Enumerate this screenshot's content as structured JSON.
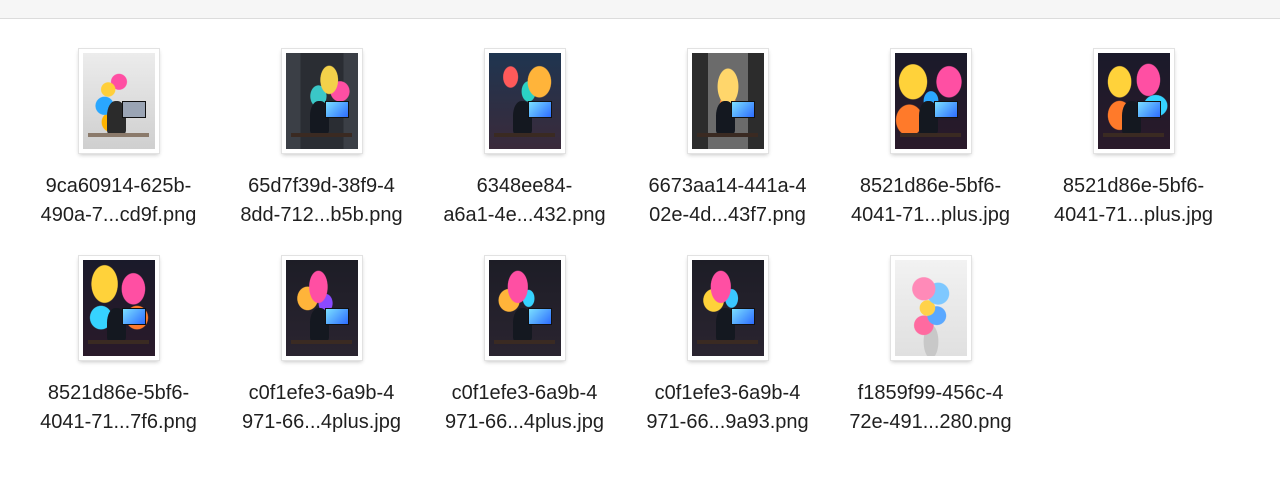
{
  "files": [
    {
      "name_line1": "9ca60914-625b-",
      "name_line2": "490a-7...cd9f.png",
      "thumbnail": "colorful-smoke-person-laptop-image"
    },
    {
      "name_line1": "65d7f39d-38f9-4",
      "name_line2": "8dd-712...b5b.png",
      "thumbnail": "dragon-bookshelf-desk-image"
    },
    {
      "name_line1": "6348ee84-",
      "name_line2": "a6a1-4e...432.png",
      "thumbnail": "dragon-desk-monitors-image"
    },
    {
      "name_line1": "6673aa14-441a-4",
      "name_line2": "02e-4d...43f7.png",
      "thumbnail": "golden-dragon-window-desk-image"
    },
    {
      "name_line1": "8521d86e-5bf6-",
      "name_line2": "4041-71...plus.jpg",
      "thumbnail": "neon-dragon-gamer-image"
    },
    {
      "name_line1": "8521d86e-5bf6-",
      "name_line2": "4041-71...plus.jpg",
      "thumbnail": "neon-dragon-gamer-image"
    },
    {
      "name_line1": "8521d86e-5bf6-",
      "name_line2": "4041-71...7f6.png",
      "thumbnail": "neon-dragon-gamer-image"
    },
    {
      "name_line1": "c0f1efe3-6a9b-4",
      "name_line2": "971-66...4plus.jpg",
      "thumbnail": "pink-dragon-workstation-image"
    },
    {
      "name_line1": "c0f1efe3-6a9b-4",
      "name_line2": "971-66...4plus.jpg",
      "thumbnail": "pink-dragon-workstation-image"
    },
    {
      "name_line1": "c0f1efe3-6a9b-4",
      "name_line2": "971-66...9a93.png",
      "thumbnail": "pink-dragon-workstation-image"
    },
    {
      "name_line1": "f1859f99-456c-4",
      "name_line2": "72e-491...280.png",
      "thumbnail": "colorful-smoke-sculpture-image"
    }
  ]
}
